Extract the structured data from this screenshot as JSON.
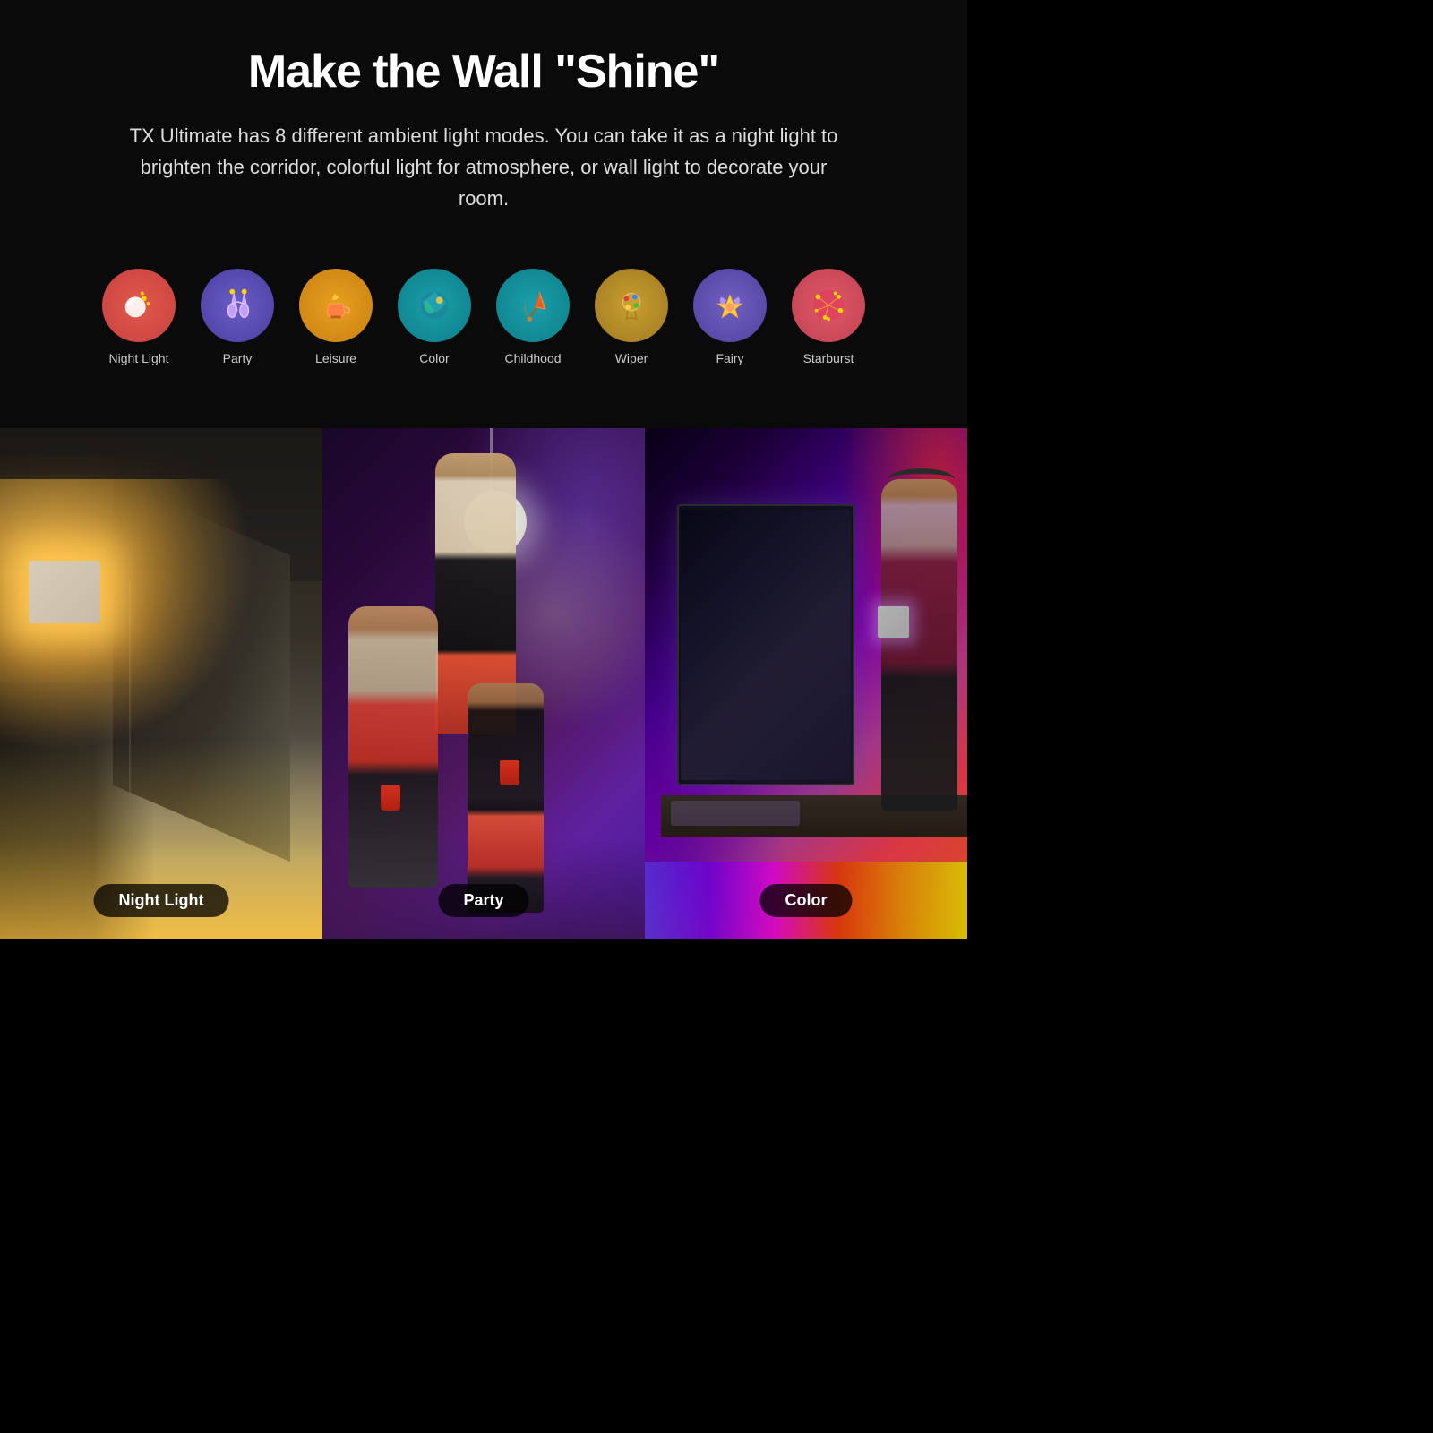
{
  "header": {
    "title": "Make the Wall \"Shine\"",
    "subtitle": "TX Ultimate has 8 different ambient light modes. You can take it as a night light to brighten the corridor, colorful light for atmosphere, or wall light to decorate your room."
  },
  "modes": [
    {
      "id": "night-light",
      "label": "Night Light",
      "icon": "🌙",
      "icon_class": "icon-night"
    },
    {
      "id": "party",
      "label": "Party",
      "icon": "🥂",
      "icon_class": "icon-party"
    },
    {
      "id": "leisure",
      "label": "Leisure",
      "icon": "☕",
      "icon_class": "icon-leisure"
    },
    {
      "id": "color",
      "label": "Color",
      "icon": "🌍",
      "icon_class": "icon-color"
    },
    {
      "id": "childhood",
      "label": "Childhood",
      "icon": "🪁",
      "icon_class": "icon-childhood"
    },
    {
      "id": "wiper",
      "label": "Wiper",
      "icon": "🎨",
      "icon_class": "icon-wiper"
    },
    {
      "id": "fairy",
      "label": "Fairy",
      "icon": "👑",
      "icon_class": "icon-fairy"
    },
    {
      "id": "starburst",
      "label": "Starburst",
      "icon": "✨",
      "icon_class": "icon-starburst"
    }
  ],
  "photos": [
    {
      "id": "night-light-photo",
      "label": "Night Light"
    },
    {
      "id": "party-photo",
      "label": "Party"
    },
    {
      "id": "color-photo",
      "label": "Color"
    }
  ]
}
